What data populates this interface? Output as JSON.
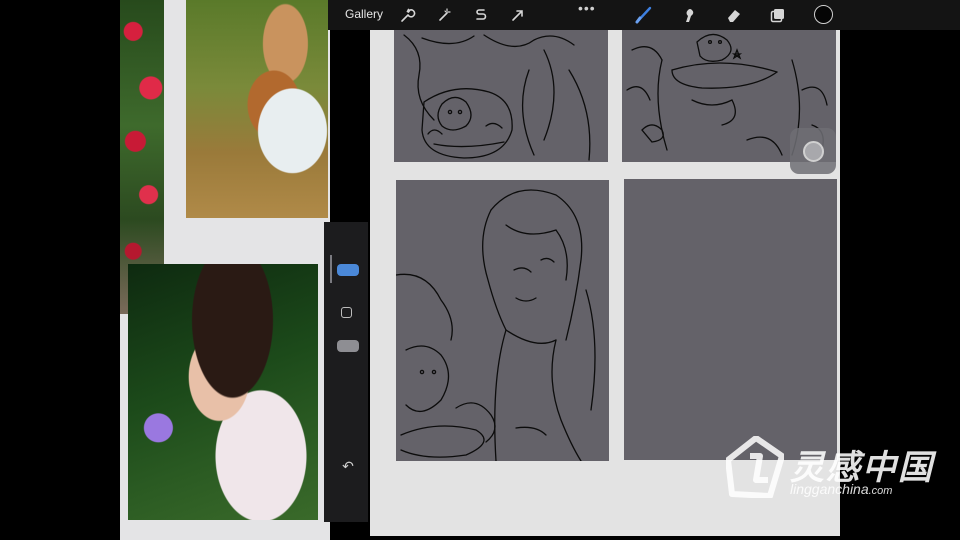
{
  "toolbar": {
    "gallery_label": "Gallery",
    "more_label": "•••",
    "icons": [
      "wrench-icon",
      "magic-wand-icon",
      "selection-s-icon",
      "transform-arrow-icon",
      "brush-icon",
      "smudge-icon",
      "eraser-icon",
      "layers-icon",
      "color-swatch"
    ],
    "accent": "#3d7fe0"
  },
  "sidebar": {
    "undo_label": "↶",
    "accent": "#4a88d8"
  },
  "watermark": {
    "title": "灵感中国",
    "url_main": "lingganchina",
    "url_suffix": ".com"
  },
  "colors": {
    "panel": "#646269",
    "canvas": "#e3e3e3",
    "toolbar": "#141414"
  }
}
